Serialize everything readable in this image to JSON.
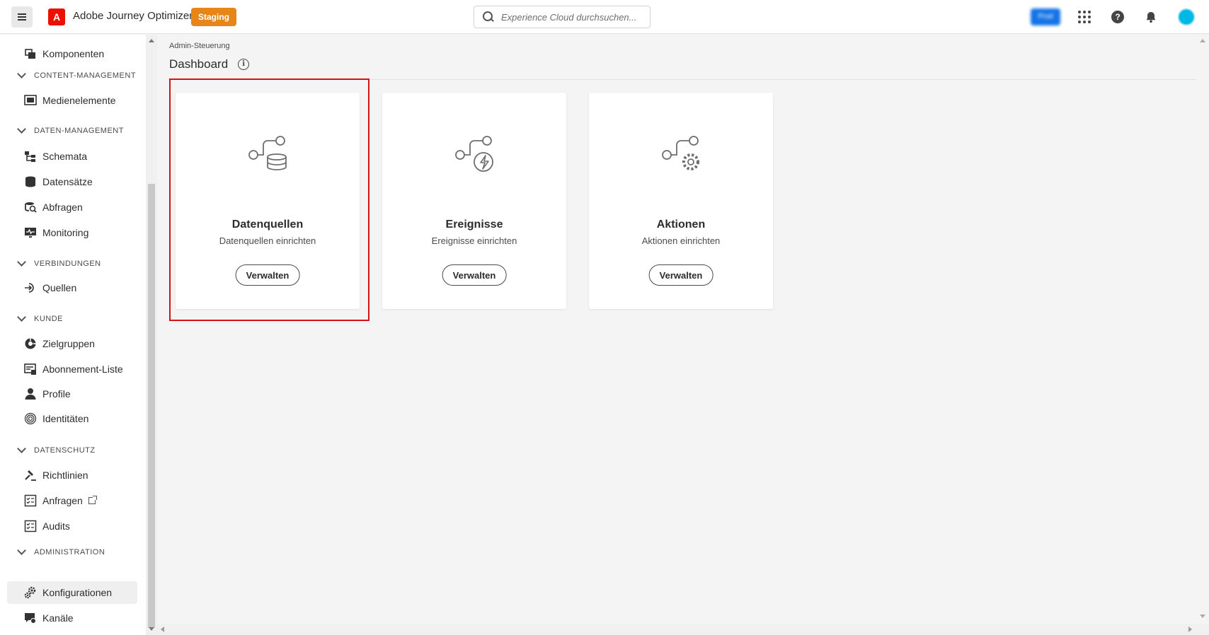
{
  "header": {
    "app_title": "Adobe Journey Optimizer",
    "environment_badge": "Staging",
    "search_placeholder": "Experience Cloud durchsuchen...",
    "org_switcher": "Prod",
    "brand_color": "#eb1000",
    "badge_color": "#e68619"
  },
  "sidebar": {
    "items": {
      "komponenten": "Komponenten",
      "medienelemente": "Medienelemente",
      "schemata": "Schemata",
      "datensaetze": "Datensätze",
      "abfragen": "Abfragen",
      "monitoring": "Monitoring",
      "quellen": "Quellen",
      "zielgruppen": "Zielgruppen",
      "abonnement_liste": "Abonnement-Liste",
      "profile": "Profile",
      "identitaeten": "Identitäten",
      "richtlinien": "Richtlinien",
      "anfragen": "Anfragen",
      "audits": "Audits",
      "konfigurationen": "Konfigurationen",
      "kanaele": "Kanäle"
    },
    "sections": {
      "content_management": "CONTENT-MANAGEMENT",
      "daten_management": "DATEN-MANAGEMENT",
      "verbindungen": "VERBINDUNGEN",
      "kunde": "KUNDE",
      "datenschutz": "DATENSCHUTZ",
      "administration": "ADMINISTRATION"
    },
    "active_item": "Konfigurationen"
  },
  "main": {
    "breadcrumb": "Admin-Steuerung",
    "title": "Dashboard",
    "cards": [
      {
        "title": "Datenquellen",
        "subtitle": "Datenquellen einrichten",
        "button": "Verwalten",
        "icon": "data-source-icon",
        "highlighted": true
      },
      {
        "title": "Ereignisse",
        "subtitle": "Ereignisse einrichten",
        "button": "Verwalten",
        "icon": "event-icon",
        "highlighted": false
      },
      {
        "title": "Aktionen",
        "subtitle": "Aktionen einrichten",
        "button": "Verwalten",
        "icon": "action-icon",
        "highlighted": false
      }
    ],
    "highlight_color": "#d4121a"
  }
}
